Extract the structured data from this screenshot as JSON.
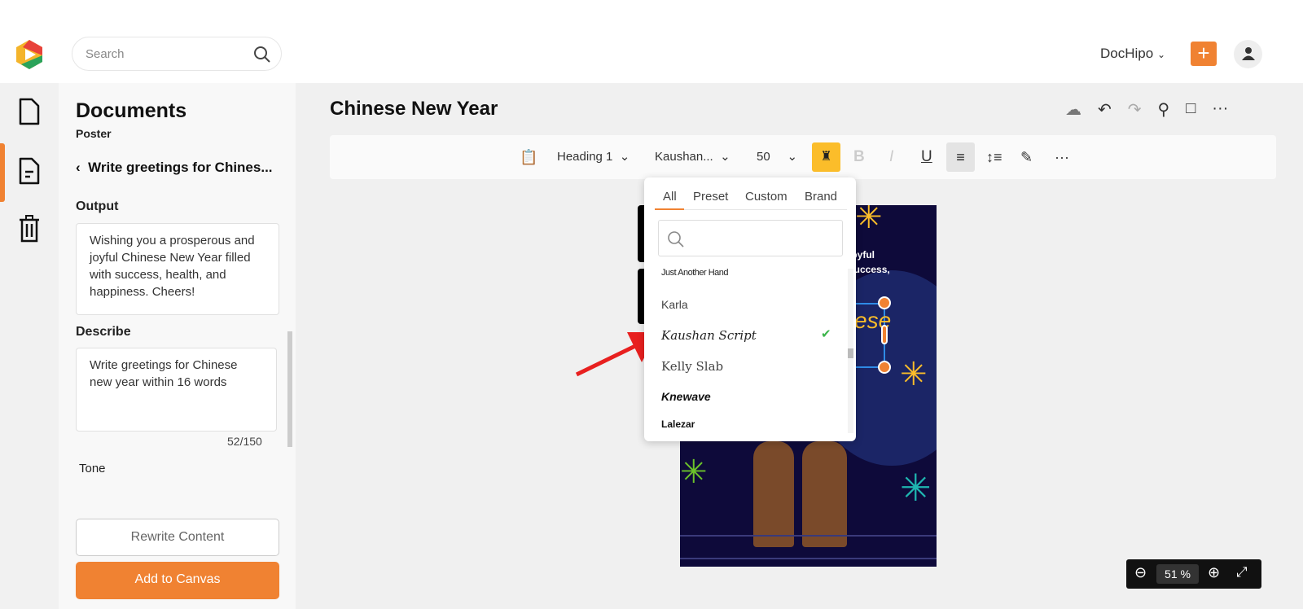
{
  "header": {
    "search_placeholder": "Search",
    "account": "DocHipo"
  },
  "panel": {
    "title": "Documents",
    "subtitle": "Poster",
    "back_label": "Write greetings for Chines...",
    "output_label": "Output",
    "output_text": "Wishing you a prosperous and joyful Chinese New Year filled with success, health, and happiness. Cheers!",
    "describe_label": "Describe",
    "describe_text": "Write greetings for Chinese new year within 16 words",
    "char_count": "52/150",
    "tone_label": "Tone",
    "rewrite_label": "Rewrite Content",
    "add_label": "Add to Canvas"
  },
  "doc": {
    "title": "Chinese New Year"
  },
  "toolbar": {
    "style": "Heading 1",
    "font": "Kaushan...",
    "size": "50"
  },
  "font_dropdown": {
    "tabs": [
      "All",
      "Preset",
      "Custom",
      "Brand"
    ],
    "active_tab": "All",
    "fonts": [
      "Just Another Hand",
      "Karla",
      "Kaushan Script",
      "Kelly Slab",
      "Knewave",
      "Lalezar"
    ],
    "selected": "Kaushan Script"
  },
  "poster": {
    "line1": "joyful",
    "line2": "success,",
    "heading_fragment": "ese"
  },
  "zoom": {
    "value": "51",
    "unit": "%"
  },
  "colors": {
    "accent": "#f08232",
    "poster_bg": "#0e0a3a",
    "highlight": "#fbbd2a"
  }
}
